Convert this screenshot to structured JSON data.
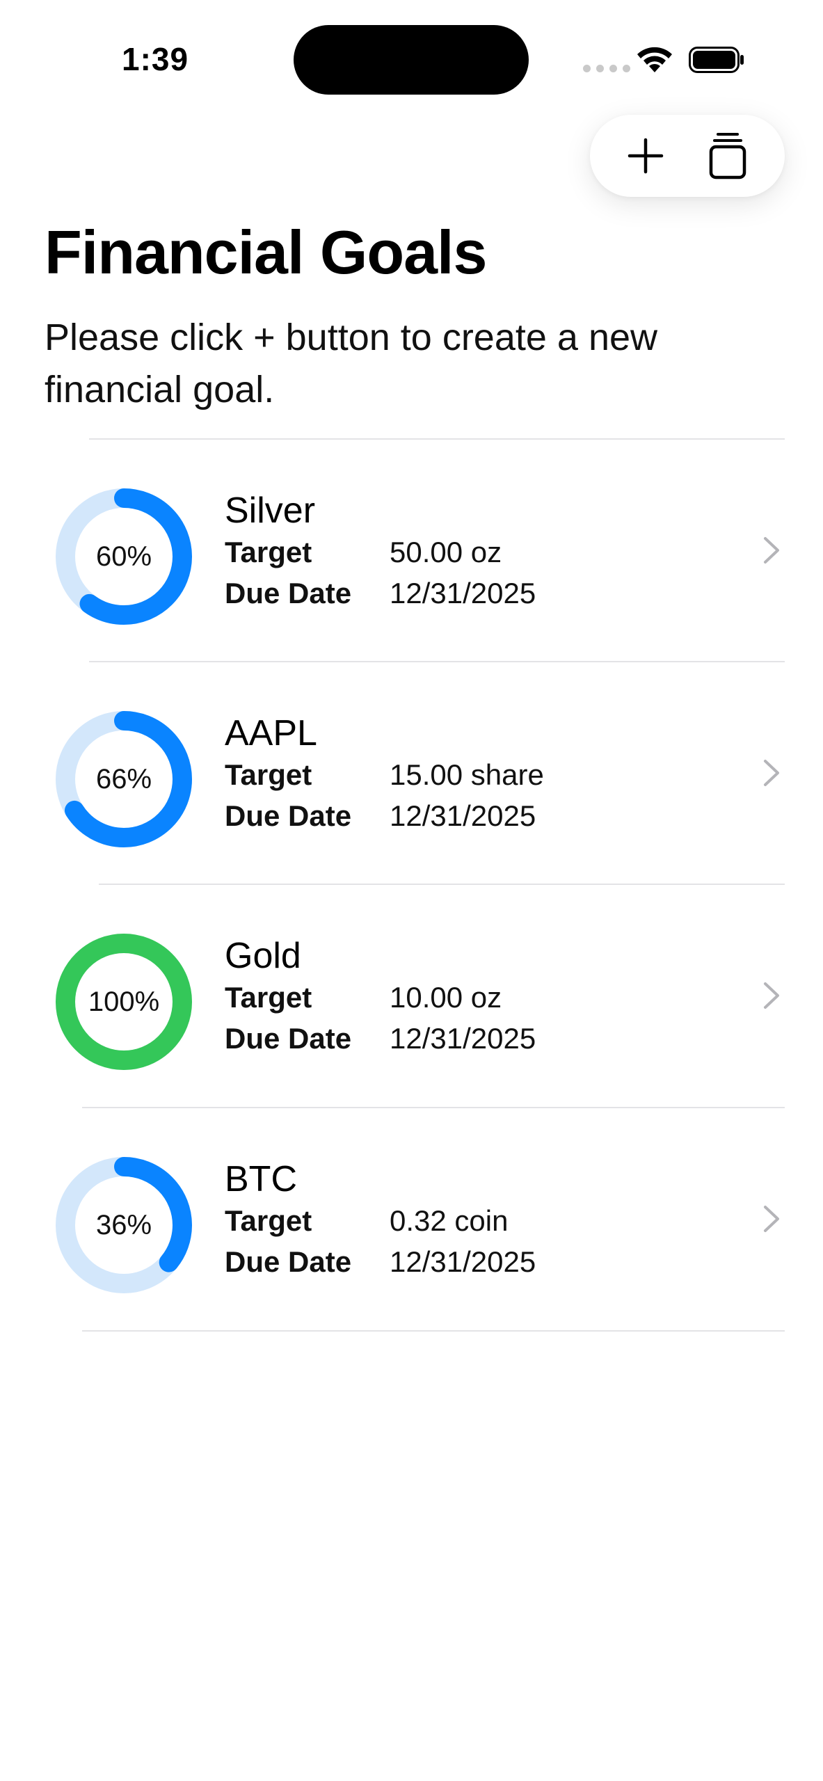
{
  "status_bar": {
    "time": "1:39"
  },
  "toolbar": {
    "add_icon": "plus-icon",
    "stack_icon": "stack-icon"
  },
  "header": {
    "title": "Financial Goals",
    "subtitle": "Please click + button to create a new financial goal."
  },
  "labels": {
    "target": "Target",
    "due_date": "Due Date"
  },
  "goals": [
    {
      "name": "Silver",
      "progress": 0.6,
      "progress_label": "60%",
      "target": "50.00 oz",
      "due_date": "12/31/2025",
      "color": "#0A84FF",
      "track": "#D3E7FB"
    },
    {
      "name": "AAPL",
      "progress": 0.66,
      "progress_label": "66%",
      "target": "15.00 share",
      "due_date": "12/31/2025",
      "color": "#0A84FF",
      "track": "#D3E7FB"
    },
    {
      "name": "Gold",
      "progress": 1.0,
      "progress_label": "100%",
      "target": "10.00 oz",
      "due_date": "12/31/2025",
      "color": "#34C759",
      "track": "#D6F2DD"
    },
    {
      "name": "BTC",
      "progress": 0.36,
      "progress_label": "36%",
      "target": "0.32 coin",
      "due_date": "12/31/2025",
      "color": "#0A84FF",
      "track": "#D3E7FB"
    }
  ]
}
